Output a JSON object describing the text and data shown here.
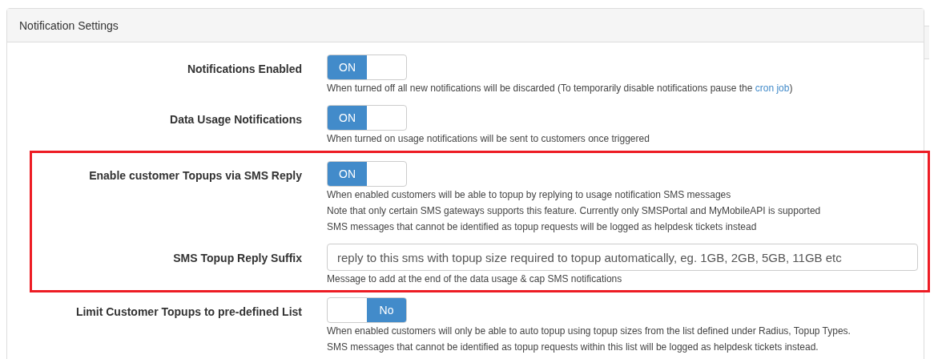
{
  "panel": {
    "title": "Notification Settings"
  },
  "rows": [
    {
      "kind": "toggle",
      "label": "Notifications Enabled",
      "on": true,
      "toggle_text": "ON",
      "highlighted": false,
      "help": [
        {
          "text": "When turned off all new notifications will be discarded (To temporarily disable notifications pause the ",
          "link": "cron job",
          "tail": ")"
        }
      ]
    },
    {
      "kind": "toggle",
      "label": "Data Usage Notifications",
      "on": true,
      "toggle_text": "ON",
      "highlighted": false,
      "help": [
        {
          "text": "When turned on usage notifications will be sent to customers once triggered"
        }
      ]
    },
    {
      "kind": "toggle",
      "label": "Enable customer Topups via SMS Reply",
      "on": true,
      "toggle_text": "ON",
      "highlighted": true,
      "help": [
        {
          "text": "When enabled customers will be able to topup by replying to usage notification SMS messages"
        },
        {
          "text": "Note that only certain SMS gateways supports this feature. Currently only SMSPortal and MyMobileAPI is supported"
        },
        {
          "text": "SMS messages that cannot be identified as topup requests will be logged as helpdesk tickets instead"
        }
      ]
    },
    {
      "kind": "text",
      "label": "SMS Topup Reply Suffix",
      "value": "reply to this sms with topup size required to topup automatically, eg. 1GB, 2GB, 5GB, 11GB etc",
      "highlighted": true,
      "help": [
        {
          "text": "Message to add at the end of the data usage & cap SMS notifications"
        }
      ]
    },
    {
      "kind": "toggle",
      "label": "Limit Customer Topups to pre-defined List",
      "on": false,
      "toggle_text": "No",
      "highlighted": false,
      "help": [
        {
          "text": "When enabled customers will only be able to auto topup using topup sizes from the list defined under Radius, Topup Types."
        },
        {
          "text": "SMS messages that cannot be identified as topup requests within this list will be logged as helpdesk tickets instead."
        }
      ]
    }
  ]
}
